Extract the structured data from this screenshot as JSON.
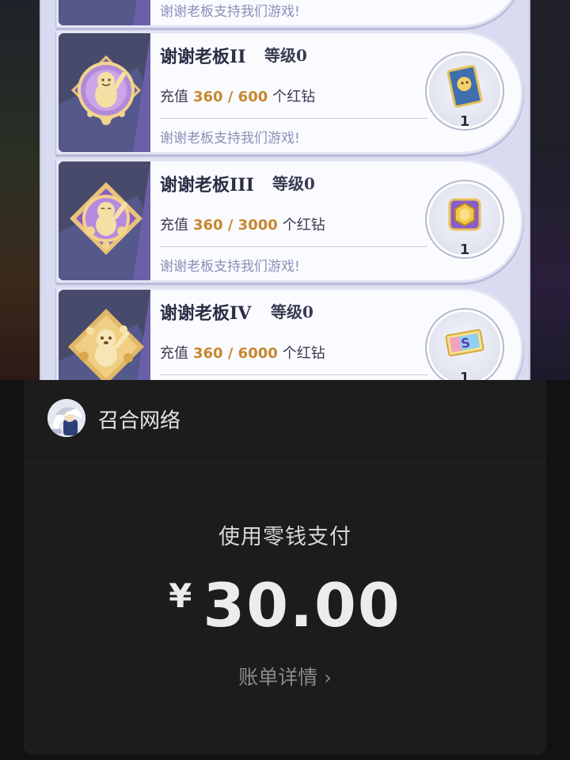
{
  "game": {
    "cards": [
      {
        "title": "谢谢老板II",
        "level": "等级0",
        "progress_prefix": "充值",
        "progress_value": "360 / 600",
        "progress_suffix": "个红钻",
        "desc": "谢谢老板支持我们游戏!",
        "reward_icon": "card-icon",
        "reward_count": "1"
      },
      {
        "title": "谢谢老板III",
        "level": "等级0",
        "progress_prefix": "充值",
        "progress_value": "360 / 3000",
        "progress_suffix": "个红钻",
        "desc": "谢谢老板支持我们游戏!",
        "reward_icon": "hexagon-box-icon",
        "reward_count": "1"
      },
      {
        "title": "谢谢老板IV",
        "level": "等级0",
        "progress_prefix": "充值",
        "progress_value": "360 / 6000",
        "progress_suffix": "个红钻",
        "desc": "",
        "reward_icon": "ticket-s-icon",
        "reward_count": "1"
      }
    ],
    "top_partial_desc": "谢谢老板支持我们游戏!"
  },
  "payment": {
    "merchant_name": "召合网络",
    "method": "使用零钱支付",
    "currency_symbol": "¥",
    "amount": "30.00",
    "bill_details_label": "账单详情"
  },
  "colors": {
    "accent_gold": "#c8862e",
    "desc_purple": "#8b8fb8",
    "sheet_bg": "#1c1c1c"
  }
}
